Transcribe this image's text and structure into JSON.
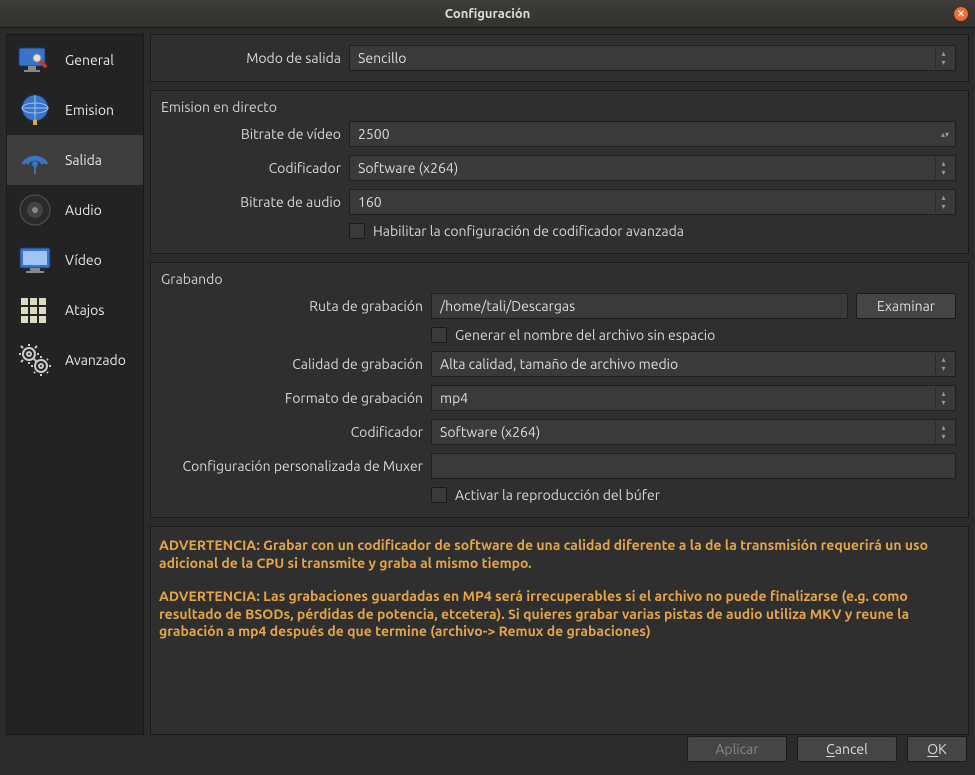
{
  "window": {
    "title": "Configuración"
  },
  "sidebar": {
    "items": [
      {
        "label": "General"
      },
      {
        "label": "Emision"
      },
      {
        "label": "Salida"
      },
      {
        "label": "Audio"
      },
      {
        "label": "Vídeo"
      },
      {
        "label": "Atajos"
      },
      {
        "label": "Avanzado"
      }
    ]
  },
  "output_mode": {
    "label": "Modo de salida",
    "value": "Sencillo"
  },
  "streaming": {
    "title": "Emision en directo",
    "video_bitrate": {
      "label": "Bitrate de vídeo",
      "value": "2500"
    },
    "encoder": {
      "label": "Codificador",
      "value": "Software (x264)"
    },
    "audio_bitrate": {
      "label": "Bitrate de audio",
      "value": "160"
    },
    "advanced_checkbox_label": "Habilitar la configuración de codificador avanzada"
  },
  "recording": {
    "title": "Grabando",
    "path": {
      "label": "Ruta de grabación",
      "value": "/home/tali/Descargas"
    },
    "browse_button": "Examinar",
    "no_space_checkbox_label": "Generar el nombre del archivo sin espacio",
    "quality": {
      "label": "Calidad de grabación",
      "value": "Alta calidad, tamaño de archivo medio"
    },
    "format": {
      "label": "Formato de grabación",
      "value": "mp4"
    },
    "encoder": {
      "label": "Codificador",
      "value": "Software (x264)"
    },
    "muxer": {
      "label": "Configuración personalizada de Muxer",
      "value": ""
    },
    "buffer_checkbox_label": "Activar la reproducción del búfer"
  },
  "warnings": {
    "w1": "ADVERTENCIA: Grabar con un codificador de software de una calidad diferente a la de la transmisión requerirá un uso adicional de la CPU si transmite y graba al mismo tiempo.",
    "w2": "ADVERTENCIA: Las grabaciones guardadas en MP4 será irrecuperables si el archivo no puede finalizarse (e.g. como resultado de BSODs, pérdidas de potencia, etcetera). Si quieres grabar varias pistas de audio utiliza MKV y reune la grabación a mp4 después de que termine (archivo-> Remux de grabaciones)"
  },
  "footer": {
    "apply": "Aplicar",
    "cancel": "Cancel",
    "ok": "OK"
  }
}
